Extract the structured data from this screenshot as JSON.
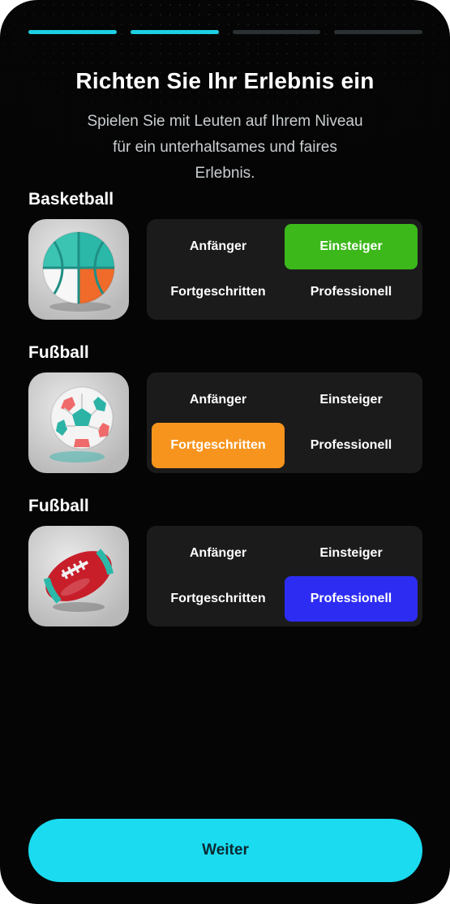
{
  "progress": {
    "total_steps": 4,
    "completed_steps": 2,
    "active_color": "#1dcfe3"
  },
  "header": {
    "title": "Richten Sie Ihr Erlebnis ein",
    "subtitle_lines": [
      "Spielen Sie mit Leuten auf Ihrem Niveau",
      "für ein unterhaltsames und faires",
      "Erlebnis."
    ]
  },
  "sports": [
    {
      "label": "Basketball",
      "icon": "basketball-icon",
      "levels": [
        "Anfänger",
        "Einsteiger",
        "Fortgeschritten",
        "Professionell"
      ],
      "selected": "Einsteiger",
      "selected_color": "#3cb81a"
    },
    {
      "label": "Fußball",
      "icon": "soccer-ball-icon",
      "levels": [
        "Anfänger",
        "Einsteiger",
        "Fortgeschritten",
        "Professionell"
      ],
      "selected": "Fortgeschritten",
      "selected_color": "#f7941d"
    },
    {
      "label": "Fußball",
      "icon": "american-football-icon",
      "levels": [
        "Anfänger",
        "Einsteiger",
        "Fortgeschritten",
        "Professionell"
      ],
      "selected": "Professionell",
      "selected_color": "#2d2cf2"
    }
  ],
  "footer": {
    "continue_label": "Weiter"
  }
}
